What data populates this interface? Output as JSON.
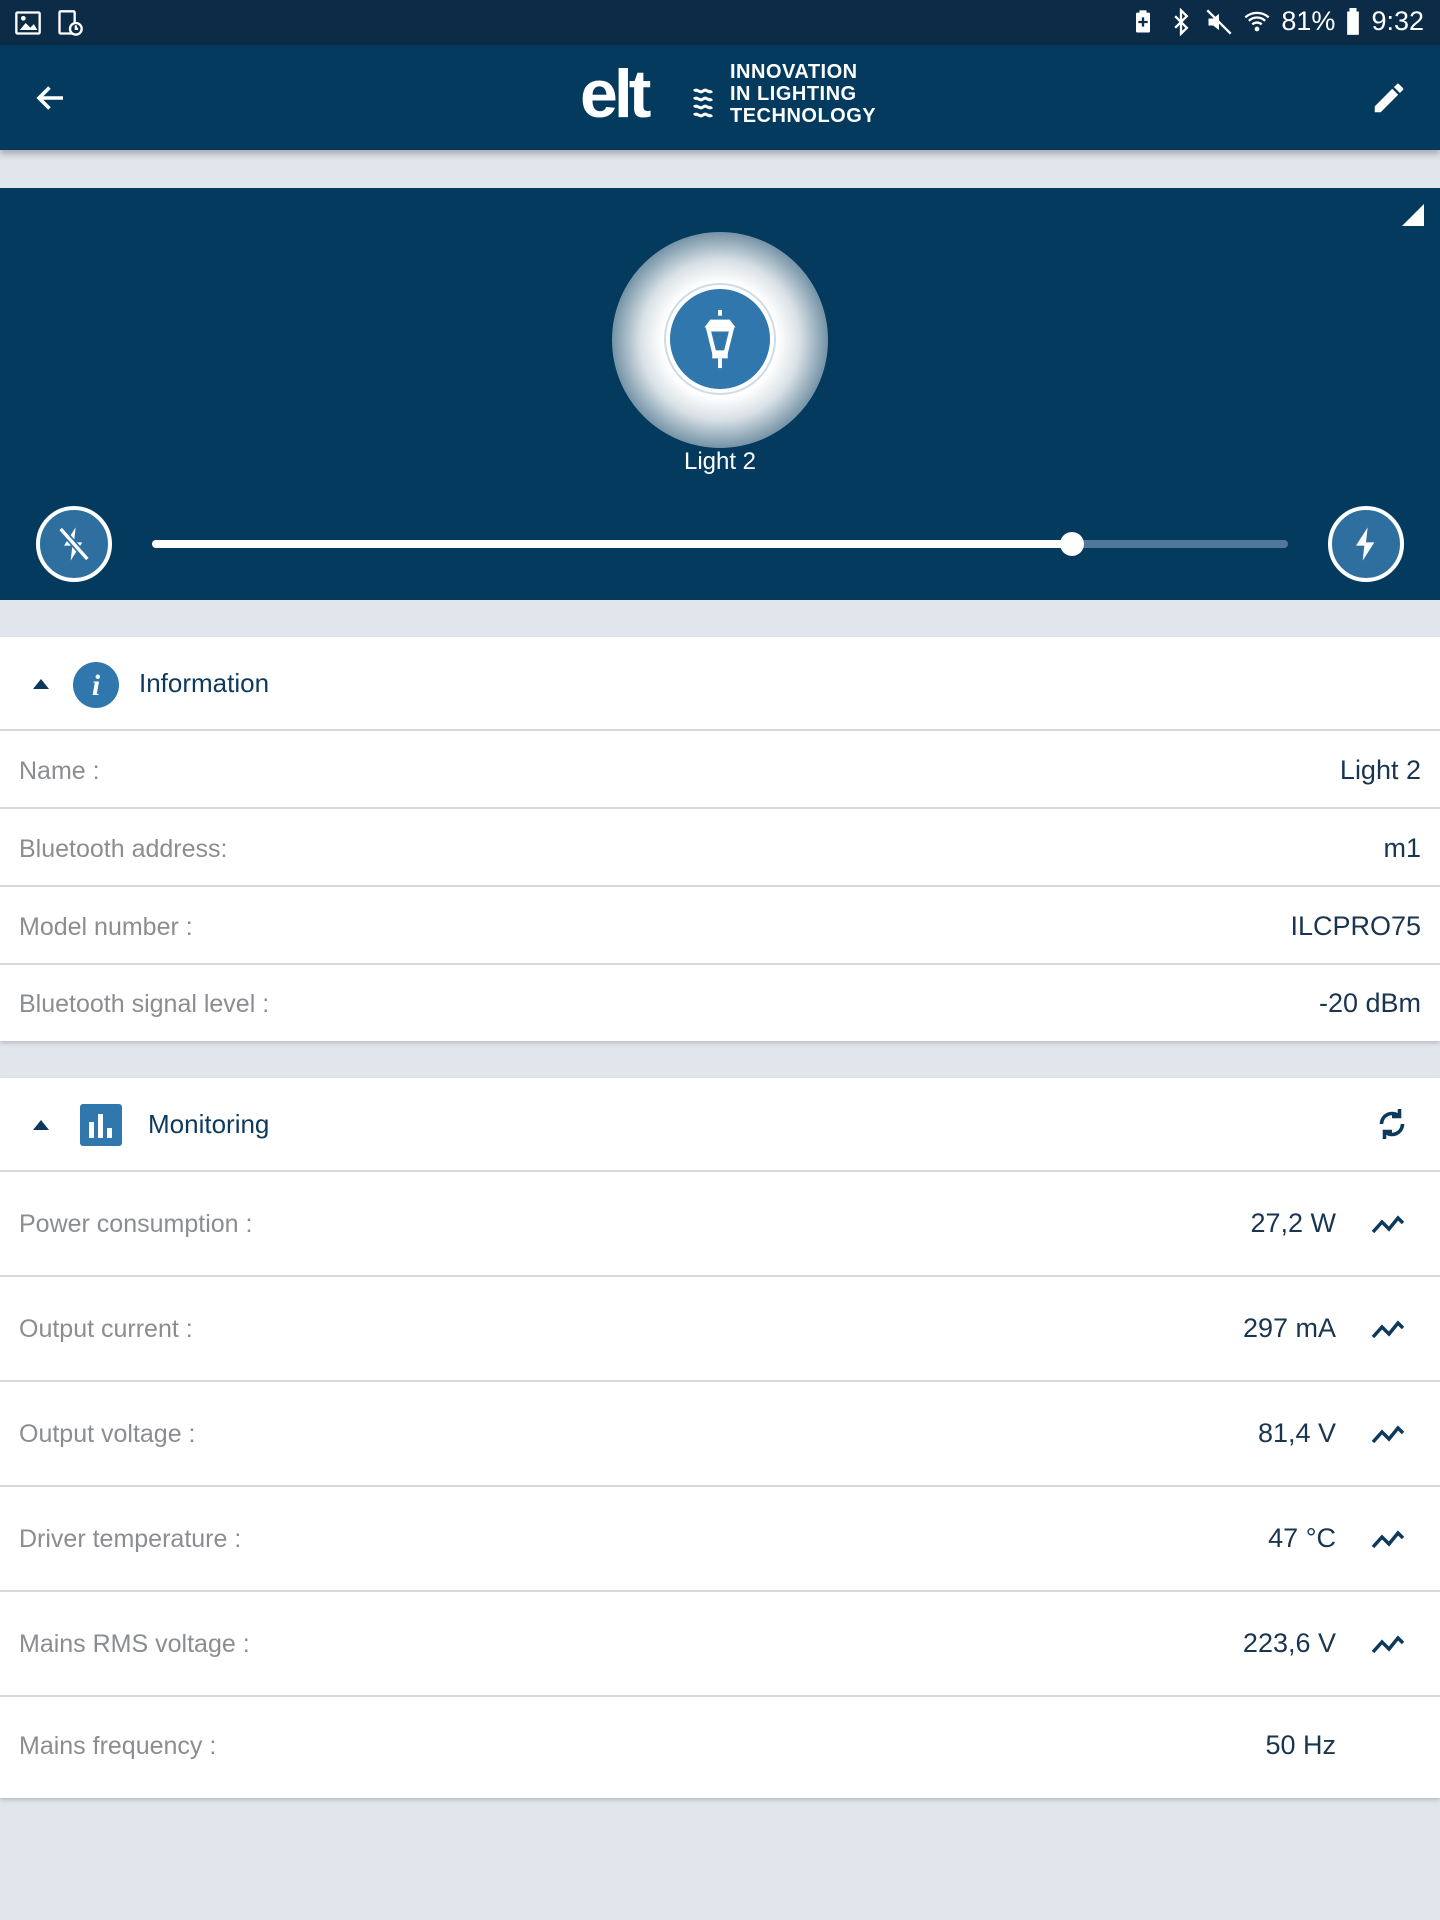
{
  "status_bar": {
    "battery_percent": "81%",
    "time": "9:32",
    "left_icons": [
      "gallery-icon",
      "screenshot-icon"
    ],
    "right_icons": [
      "battery-saver-icon",
      "bluetooth-icon",
      "mute-icon",
      "wifi-icon",
      "battery-icon"
    ]
  },
  "app_bar": {
    "logo_text": "elt",
    "tagline": [
      "INNOVATION",
      "IN LIGHTING",
      "TECHNOLOGY"
    ],
    "back_icon": "arrow-left-icon",
    "edit_icon": "pencil-icon"
  },
  "control": {
    "light_name": "Light 2",
    "brightness_fraction": 0.81,
    "off_icon": "flash-off-icon",
    "on_icon": "flash-on-icon",
    "lamp_icon": "street-lamp-icon",
    "colors": {
      "panel": "#033a5d",
      "lamp_circle": "#2f77ad",
      "track": "#51789a"
    }
  },
  "information": {
    "title": "Information",
    "rows": [
      {
        "label": "Name :",
        "value": "Light 2"
      },
      {
        "label": "Bluetooth address:",
        "value": "m1"
      },
      {
        "label": "Model number :",
        "value": "ILCPRO75"
      },
      {
        "label": "Bluetooth signal level :",
        "value": "-20 dBm"
      }
    ]
  },
  "monitoring": {
    "title": "Monitoring",
    "rows": [
      {
        "label": "Power consumption :",
        "value": "27,2 W",
        "trend": true
      },
      {
        "label": "Output current :",
        "value": "297 mA",
        "trend": true
      },
      {
        "label": "Output voltage :",
        "value": "81,4 V",
        "trend": true
      },
      {
        "label": "Driver temperature :",
        "value": "47 °C",
        "trend": true
      },
      {
        "label": "Mains RMS voltage :",
        "value": "223,6 V",
        "trend": true
      },
      {
        "label": "Mains frequency :",
        "value": "50 Hz",
        "trend": false
      }
    ]
  }
}
